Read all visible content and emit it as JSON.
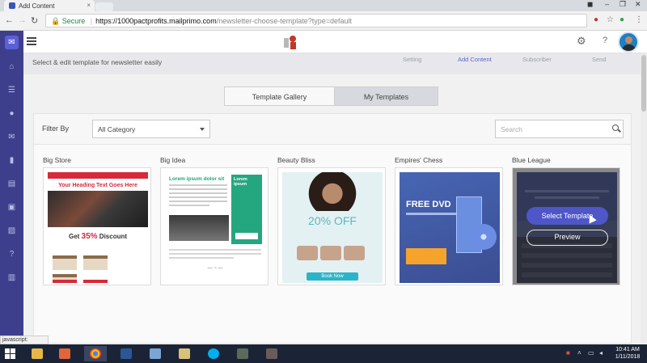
{
  "browser": {
    "tab_title": "Add Content",
    "tab_close": "×",
    "url_secure": "Secure",
    "url_host": "https://1000pactprofits.mailprimo.com",
    "url_path": "/newsletter-choose-template?type=default",
    "window_min": "–",
    "window_max": "❐",
    "window_close": "✕",
    "profile_icon": "person-icon"
  },
  "app": {
    "subtitle": "Select & edit template for newsletter easily",
    "steps": [
      {
        "label": "Setting",
        "active": false
      },
      {
        "label": "Add Content",
        "active": true
      },
      {
        "label": "Subscriber",
        "active": false
      },
      {
        "label": "Send",
        "active": false
      }
    ],
    "tabs": {
      "gallery": "Template Gallery",
      "mine": "My Templates"
    },
    "filter": {
      "label": "Filter By",
      "selected": "All Category",
      "search_placeholder": "Search"
    },
    "help_label": "?",
    "accent": "#4e56c8",
    "sidebar_color": "#3e3f8c"
  },
  "templates": [
    {
      "name": "Big Store",
      "heading": "Your Heading Text Goes Here",
      "discount_prefix": "Get",
      "discount_value": "35%",
      "discount_suffix": "Discount"
    },
    {
      "name": "Big Idea",
      "heading": "Lorem ipsum dolor sit",
      "side_heading": "Lorem ipsum"
    },
    {
      "name": "Beauty Bliss",
      "offer": "20% OFF",
      "cta": "Book Now"
    },
    {
      "name": "Empires' Chess",
      "headline": "FREE DVD"
    },
    {
      "name": "Blue League",
      "select_label": "Select Template",
      "preview_label": "Preview"
    }
  ],
  "status_text": "javascript:",
  "taskbar": {
    "time": "10:41 AM",
    "date": "1/11/2018"
  }
}
